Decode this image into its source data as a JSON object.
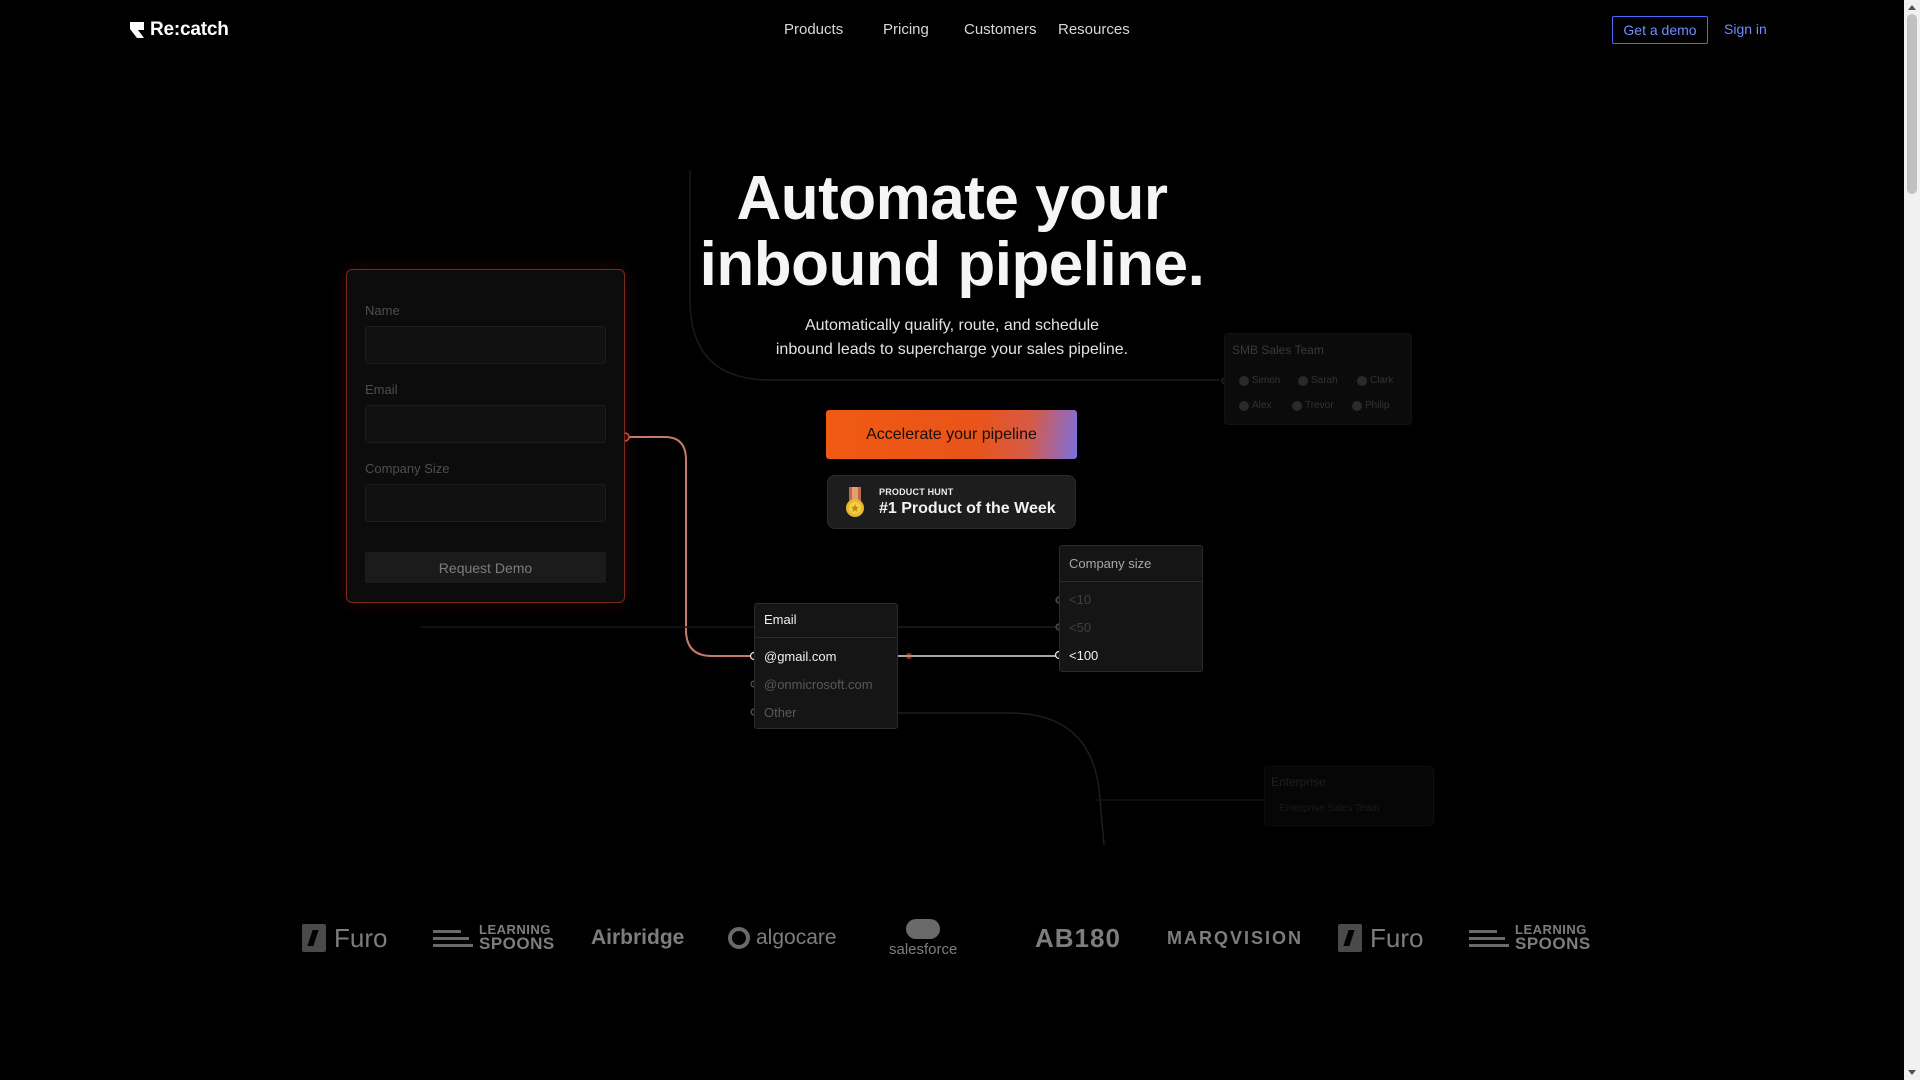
{
  "nav": {
    "brand": "Re:catch",
    "links": [
      "Products",
      "Pricing",
      "Customers",
      "Resources"
    ],
    "demo_label": "Get a demo",
    "signin_label": "Sign in"
  },
  "hero": {
    "title_line1": "Automate your",
    "title_line2": "inbound pipeline.",
    "subtitle_line1": "Automatically qualify, route, and schedule",
    "subtitle_line2": "inbound leads to supercharge your sales pipeline.",
    "cta_label": "Accelerate your pipeline"
  },
  "badge": {
    "kicker": "PRODUCT HUNT",
    "title": "#1 Product of the Week"
  },
  "form": {
    "name_label": "Name",
    "email_label": "Email",
    "company_size_label": "Company Size",
    "submit_label": "Request Demo"
  },
  "email_node": {
    "title": "Email",
    "options": [
      "@gmail.com",
      "@onmicrosoft.com",
      "Other"
    ]
  },
  "size_node": {
    "title": "Company size",
    "options": [
      "<10",
      "<50",
      "<100"
    ]
  },
  "team_card": {
    "title": "SMB Sales Team",
    "members": [
      "Simon",
      "Sarah",
      "Clark",
      "Alex",
      "Trevor",
      "Philip"
    ]
  },
  "enterprise_card": {
    "title": "Enterprise",
    "subtitle": "Enterprise Sales Team"
  },
  "logos": {
    "furo": "Furo",
    "learning_spoons_1": "LEARNING",
    "learning_spoons_2": "SPOONS",
    "airbridge": "Airbridge",
    "algocare": "algocare",
    "salesforce": "salesforce",
    "ab180": "AB180",
    "marqvision": "MARQVISION"
  },
  "colors": {
    "accent_orange": "#f05a12",
    "link_blue": "#6f8cff",
    "background": "#000000"
  }
}
